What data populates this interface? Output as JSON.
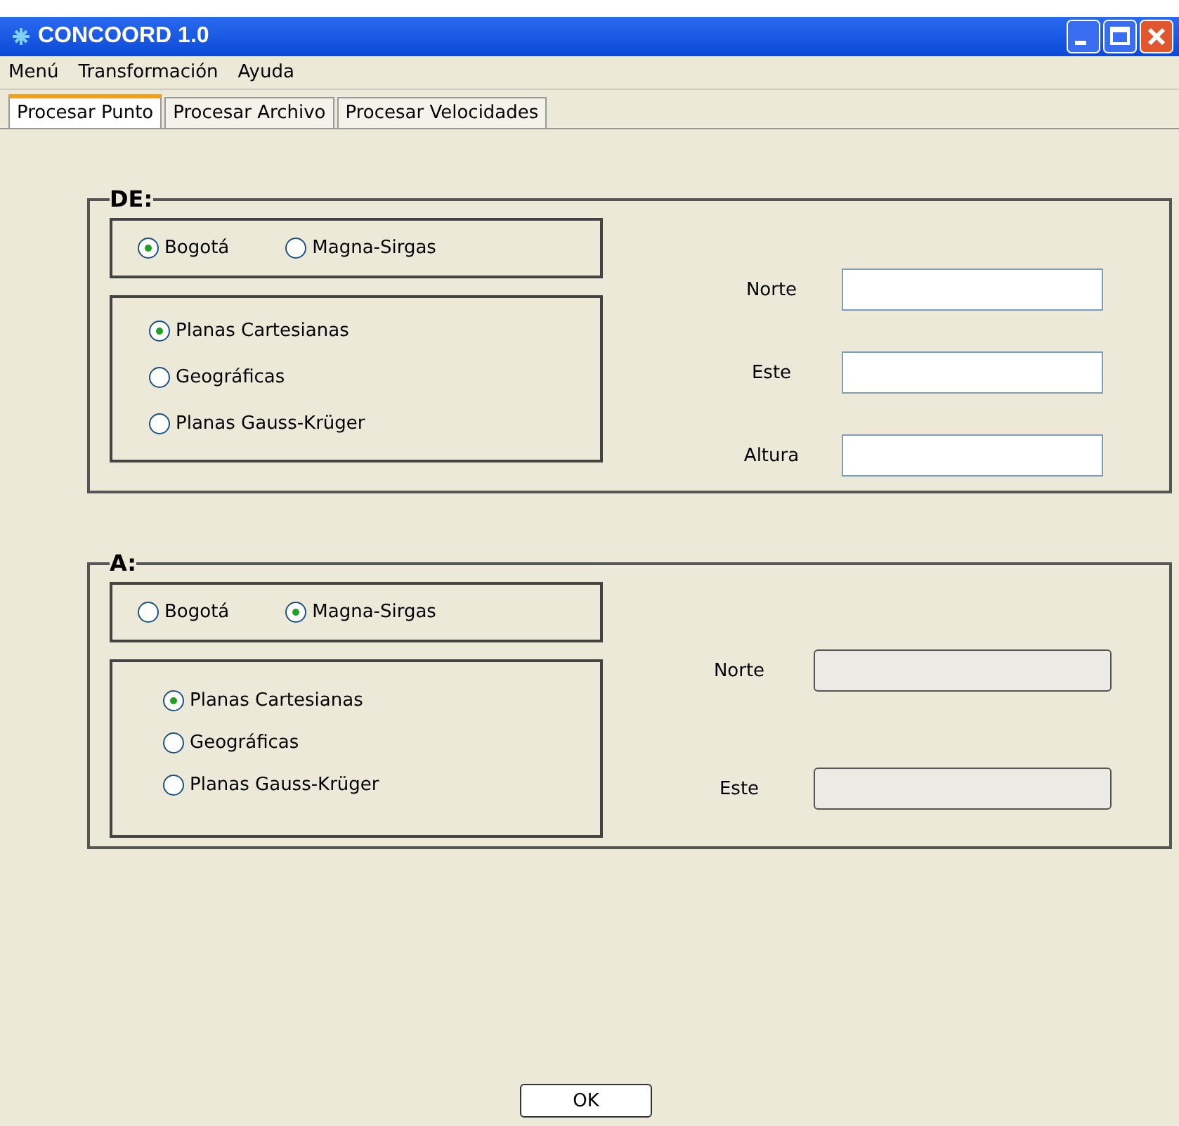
{
  "window": {
    "title": "CONCOORD 1.0"
  },
  "menu": [
    "Menú",
    "Transformación",
    "Ayuda"
  ],
  "tabs": [
    {
      "label": "Procesar Punto",
      "selected": true
    },
    {
      "label": "Procesar Archivo",
      "selected": false
    },
    {
      "label": "Procesar Velocidades",
      "selected": false
    }
  ],
  "groups": [
    {
      "title": "DE:",
      "datums": [
        {
          "label": "Bogotá",
          "selected": true
        },
        {
          "label": "Magna-Sirgas",
          "selected": false
        }
      ],
      "projections": [
        {
          "label": "Planas Cartesianas",
          "selected": true
        },
        {
          "label": "Geográficas",
          "selected": false
        },
        {
          "label": "Planas Gauss-Krüger",
          "selected": false
        }
      ],
      "fields": [
        {
          "label": "Norte",
          "disabled": false
        },
        {
          "label": "Este",
          "disabled": false
        },
        {
          "label": "Altura",
          "disabled": false
        }
      ]
    },
    {
      "title": "A:",
      "datums": [
        {
          "label": "Bogotá",
          "selected": false
        },
        {
          "label": "Magna-Sirgas",
          "selected": true
        }
      ],
      "projections": [
        {
          "label": "Planas Cartesianas",
          "selected": true
        },
        {
          "label": "Geográficas",
          "selected": false
        },
        {
          "label": "Planas Gauss-Krüger",
          "selected": false
        }
      ],
      "fields": [
        {
          "label": "Norte",
          "disabled": true
        },
        {
          "label": "Este",
          "disabled": true
        }
      ]
    }
  ],
  "ok_button": "OK"
}
